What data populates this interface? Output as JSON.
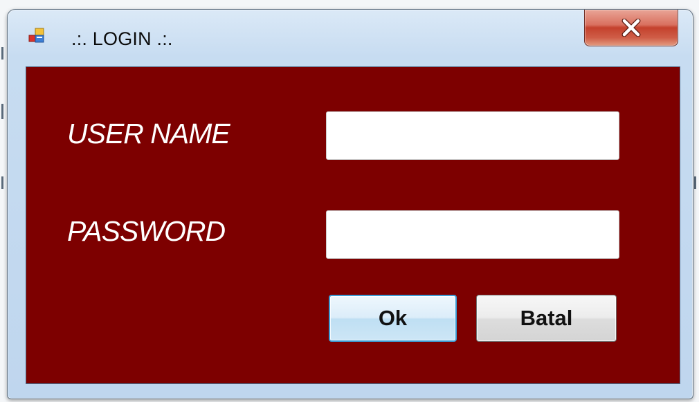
{
  "window": {
    "title": ".:. LOGIN .:.",
    "close_icon": "close-icon",
    "app_icon": "application-icon"
  },
  "form": {
    "username_label": "USER NAME",
    "password_label": "PASSWORD",
    "username_value": "",
    "password_value": ""
  },
  "buttons": {
    "ok_label": "Ok",
    "cancel_label": "Batal"
  },
  "colors": {
    "client_background": "#7d0000",
    "label_text": "#ffffff",
    "close_button": "#c4412d",
    "ok_focus_border": "#3c9fd8"
  }
}
